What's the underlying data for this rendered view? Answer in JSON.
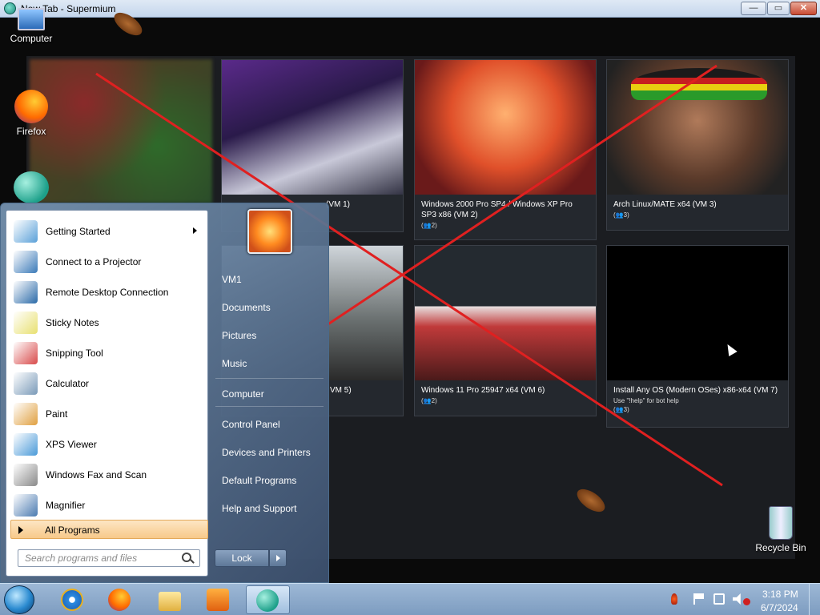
{
  "window": {
    "title": "New Tab - Supermium",
    "minimize_label": "—",
    "maximize_label": "▭",
    "close_label": "✕"
  },
  "desktop_icons": [
    {
      "label": "Computer",
      "icon": "computer-icon"
    },
    {
      "label": "Firefox",
      "icon": "firefox-icon"
    },
    {
      "label": "",
      "icon": "supermium-icon"
    },
    {
      "label": "Recycle Bin",
      "icon": "recycle-bin-icon"
    }
  ],
  "vms": [
    {
      "title": "(VM 1)",
      "meta": ""
    },
    {
      "title": "Windows 2000 Pro SP4 / Windows XP Pro SP3 x86 (VM 2)",
      "meta": "(👥2)"
    },
    {
      "title": "Arch Linux/MATE x64 (VM 3)",
      "meta": "(👥3)"
    },
    {
      "title": "VM 5)",
      "meta": ""
    },
    {
      "title": "Windows 11 Pro 25947 x64 (VM 6)",
      "meta": "(👥2)"
    },
    {
      "title": "Install Any OS (Modern OSes) x86-x64 (VM 7)",
      "subtitle": "Use \"!help\" for bot help",
      "meta": "(👥3)"
    }
  ],
  "start_menu": {
    "programs": [
      {
        "label": "Getting Started",
        "icon": "getting-started-icon",
        "color": "#5aa0d8",
        "has_arrow": true
      },
      {
        "label": "Connect to a Projector",
        "icon": "projector-icon",
        "color": "#3a7ab8"
      },
      {
        "label": "Remote Desktop Connection",
        "icon": "remote-desktop-icon",
        "color": "#2a6aa8"
      },
      {
        "label": "Sticky Notes",
        "icon": "sticky-notes-icon",
        "color": "#e8e070"
      },
      {
        "label": "Snipping Tool",
        "icon": "snipping-tool-icon",
        "color": "#d84a4a"
      },
      {
        "label": "Calculator",
        "icon": "calculator-icon",
        "color": "#7a9ab8"
      },
      {
        "label": "Paint",
        "icon": "paint-icon",
        "color": "#e0a040"
      },
      {
        "label": "XPS Viewer",
        "icon": "xps-viewer-icon",
        "color": "#4a9ad8"
      },
      {
        "label": "Windows Fax and Scan",
        "icon": "fax-scan-icon",
        "color": "#8a8a8a"
      },
      {
        "label": "Magnifier",
        "icon": "magnifier-icon",
        "color": "#4a7ab0"
      }
    ],
    "all_programs": "All Programs",
    "search_placeholder": "Search programs and files",
    "right_items": [
      "VM1",
      "Documents",
      "Pictures",
      "Music",
      "Computer",
      "Control Panel",
      "Devices and Printers",
      "Default Programs",
      "Help and Support"
    ],
    "lock_label": "Lock"
  },
  "taskbar": {
    "apps": [
      "internet-explorer-icon",
      "firefox-icon",
      "windows-explorer-icon",
      "media-player-icon",
      "supermium-icon"
    ],
    "clock_time": "3:18 PM",
    "clock_date": "6/7/2024"
  }
}
